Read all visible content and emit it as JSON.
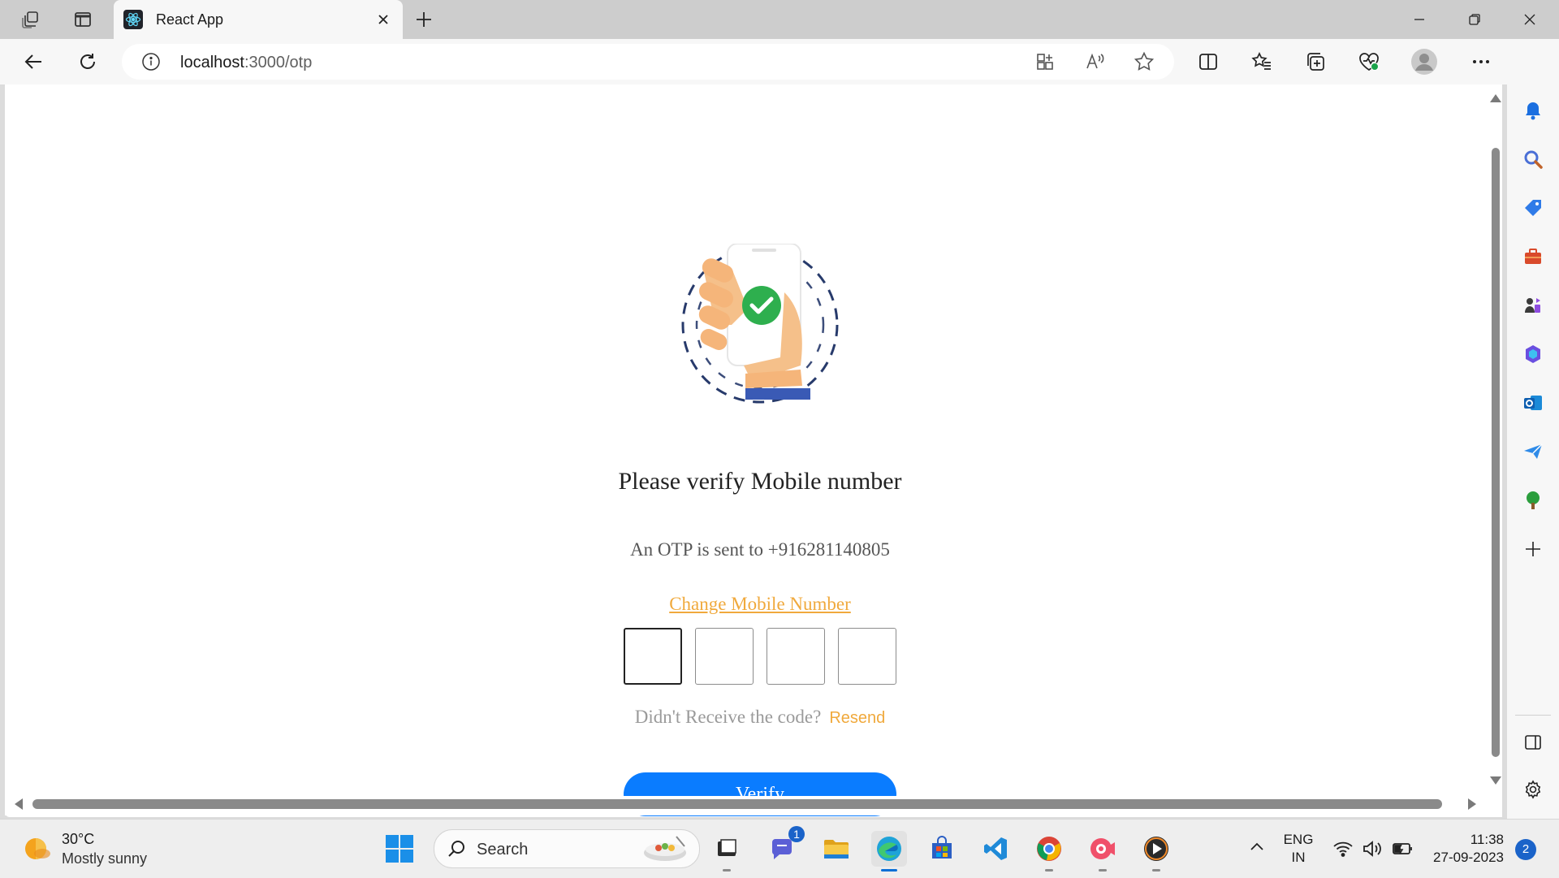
{
  "browser": {
    "tab": {
      "title": "React App"
    },
    "address": {
      "host": "localhost",
      "path": ":3000/otp"
    }
  },
  "page": {
    "heading": "Please verify Mobile number",
    "otp_sent_text": "An OTP is sent to +916281140805",
    "change_number_link": "Change Mobile Number",
    "otp_boxes": [
      "",
      "",
      "",
      ""
    ],
    "resend_prompt": "Didn't Receive the code?",
    "resend_link": "Resend",
    "verify_button": "Verify"
  },
  "taskbar": {
    "weather": {
      "temp": "30°C",
      "desc": "Mostly sunny"
    },
    "search_placeholder": "Search",
    "teams_badge": "1",
    "lang_line1": "ENG",
    "lang_line2": "IN",
    "time": "11:38",
    "date": "27-09-2023",
    "notification_count": "2"
  },
  "colors": {
    "accent": "#0a7cff",
    "link": "#f0a93c",
    "page_bg": "#ffffff",
    "chrome_bg": "#f7f7f7"
  }
}
